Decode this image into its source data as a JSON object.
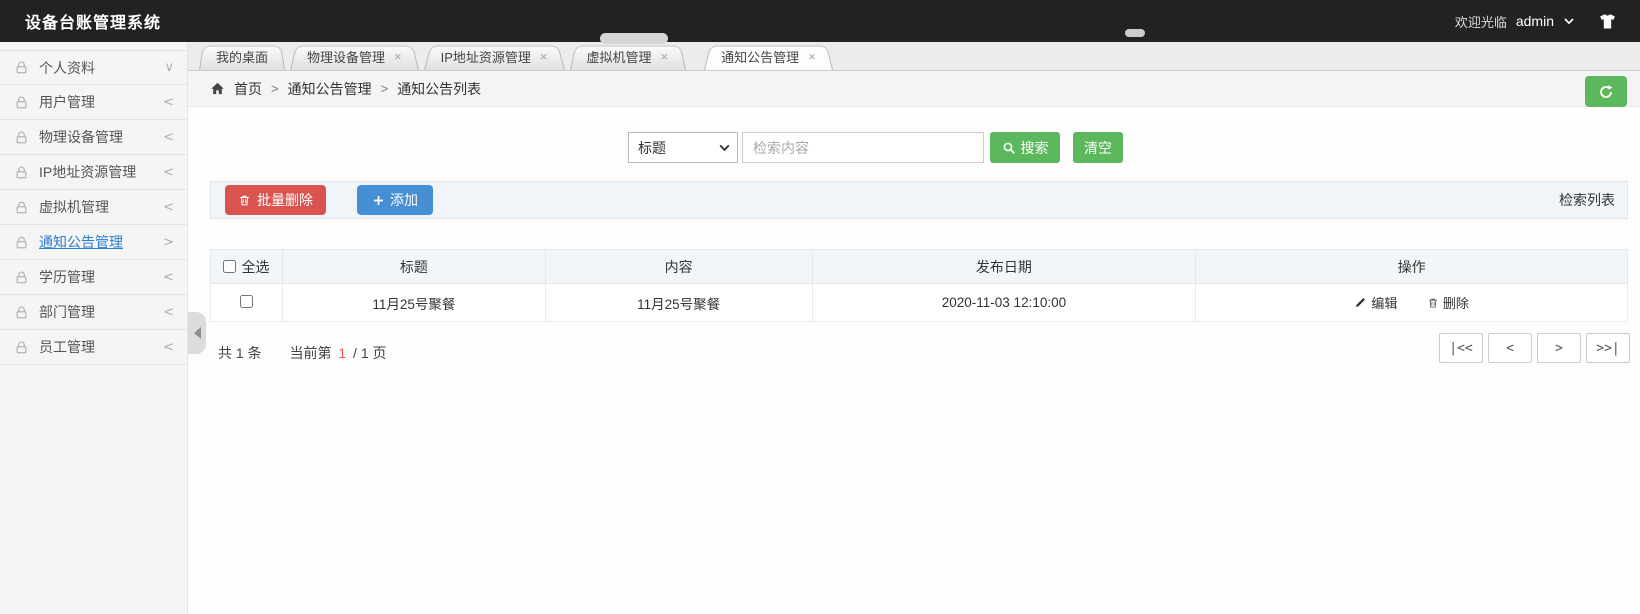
{
  "header": {
    "app_title": "设备台账管理系统",
    "welcome_text": "欢迎光临",
    "username": "admin"
  },
  "sidebar": {
    "items": [
      {
        "label": "个人资料",
        "arrow": "∨",
        "active": false
      },
      {
        "label": "用户管理",
        "arrow": "<",
        "active": false
      },
      {
        "label": "物理设备管理",
        "arrow": "<",
        "active": false
      },
      {
        "label": "IP地址资源管理",
        "arrow": "<",
        "active": false
      },
      {
        "label": "虚拟机管理",
        "arrow": "<",
        "active": false
      },
      {
        "label": "通知公告管理",
        "arrow": ">",
        "active": true
      },
      {
        "label": "学历管理",
        "arrow": "<",
        "active": false
      },
      {
        "label": "部门管理",
        "arrow": "<",
        "active": false
      },
      {
        "label": "员工管理",
        "arrow": "<",
        "active": false
      }
    ]
  },
  "tabs": [
    {
      "label": "我的桌面",
      "closable": false,
      "active": false
    },
    {
      "label": "物理设备管理",
      "closable": true,
      "active": false
    },
    {
      "label": "IP地址资源管理",
      "closable": true,
      "active": false
    },
    {
      "label": "虚拟机管理",
      "closable": true,
      "active": false
    },
    {
      "label": "通知公告管理",
      "closable": true,
      "active": true
    }
  ],
  "breadcrumb": {
    "separator": ">",
    "items": [
      "首页",
      "通知公告管理",
      "通知公告列表"
    ]
  },
  "search": {
    "field_selected": "标题",
    "placeholder": "检索内容",
    "search_label": "搜索",
    "clear_label": "清空"
  },
  "toolbar": {
    "batch_delete_label": "批量删除",
    "add_label": "添加",
    "list_title": "检索列表"
  },
  "table": {
    "select_all_label": "全选",
    "columns": [
      "标题",
      "内容",
      "发布日期",
      "操作"
    ],
    "edit_label": "编辑",
    "delete_label": "删除",
    "rows": [
      {
        "title": "11月25号聚餐",
        "content": "11月25号聚餐",
        "publish_date": "2020-11-03 12:10:00"
      }
    ]
  },
  "pagination": {
    "total_text": "共 1 条",
    "current_prefix": "当前第",
    "current_page": "1",
    "current_suffix": "/ 1 页",
    "buttons": [
      "|<<",
      "<",
      ">",
      ">>|"
    ]
  },
  "glyphs": {
    "close": "×"
  },
  "colors": {
    "header_bg": "#222222",
    "green": "#5cb85c",
    "red": "#d9534f",
    "blue": "#468fd5",
    "active_link": "#2a7fd2",
    "current_page_red": "#e9594c"
  }
}
